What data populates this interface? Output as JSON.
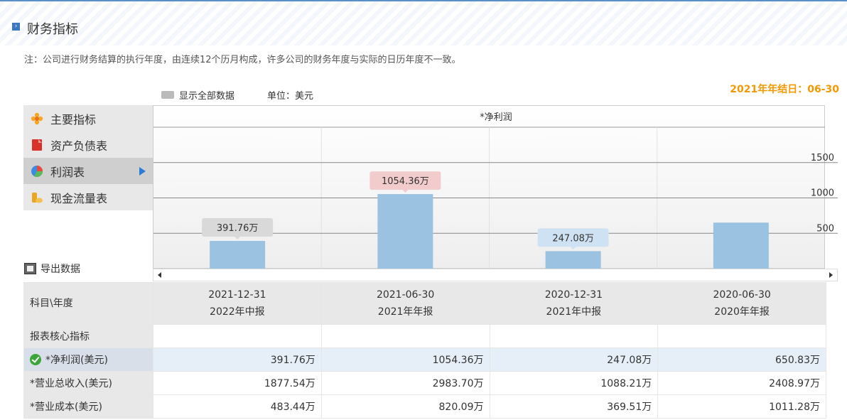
{
  "header": {
    "title": "财务指标",
    "icon": "chevron-right-icon"
  },
  "note": "注：公司进行财务结算的执行年度，由连续12个历月构成，许多公司的财务年度与实际的日历年度不一致。",
  "fiscal_year_end": "2021年年结日：06-30",
  "toolbar": {
    "show_all": "显示全部数据",
    "unit": "单位：美元"
  },
  "menu": {
    "items": [
      {
        "label": "主要指标",
        "icon": "flower-icon"
      },
      {
        "label": "资产负债表",
        "icon": "document-icon"
      },
      {
        "label": "利润表",
        "icon": "pie-chart-icon",
        "active": true
      },
      {
        "label": "现金流量表",
        "icon": "coins-icon"
      }
    ]
  },
  "export_label": "导出数据",
  "chart_data": {
    "type": "bar",
    "title": "*净利润",
    "categories": [
      "2021-12-31",
      "2021-06-30",
      "2020-12-31",
      "2020-06-30"
    ],
    "values": [
      391.76,
      1054.36,
      247.08,
      650.83
    ],
    "data_labels": [
      "391.76万",
      "1054.36万",
      "247.08万",
      ""
    ],
    "y_ticks": [
      500,
      1000,
      1500
    ],
    "ylim": [
      0,
      2000
    ],
    "bar_color": "#9bc2e1",
    "label_colors": [
      "#d9d9d9",
      "#f2cccc",
      "#cfe2f3",
      ""
    ]
  },
  "table": {
    "corner": "科目\\年度",
    "columns": [
      {
        "date": "2021-12-31",
        "report": "2022年中报"
      },
      {
        "date": "2021-06-30",
        "report": "2021年年报"
      },
      {
        "date": "2020-12-31",
        "report": "2021年中报"
      },
      {
        "date": "2020-06-30",
        "report": "2020年年报"
      }
    ],
    "section": "报表核心指标",
    "rows": [
      {
        "label": "*净利润(美元)",
        "values": [
          "391.76万",
          "1054.36万",
          "247.08万",
          "650.83万"
        ]
      },
      {
        "label": "*营业总收入(美元)",
        "values": [
          "1877.54万",
          "2983.70万",
          "1088.21万",
          "2408.97万"
        ]
      },
      {
        "label": "*营业成本(美元)",
        "values": [
          "483.44万",
          "820.09万",
          "369.51万",
          "1011.28万"
        ]
      }
    ]
  }
}
